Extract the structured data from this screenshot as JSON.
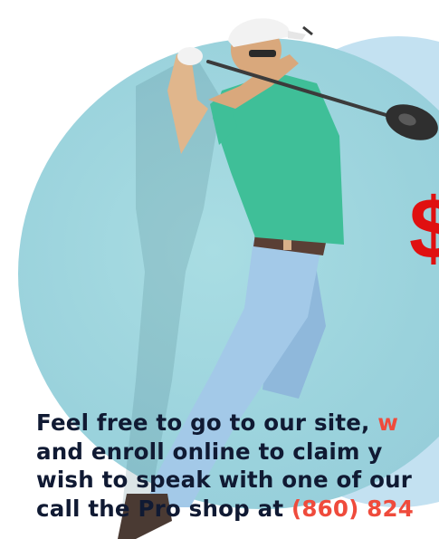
{
  "promo": {
    "dollar_sign": "$"
  },
  "body_text": {
    "line1": "Feel free to go to our site,",
    "line1_link": " w",
    "line2": "and enroll online to claim y",
    "line3": "wish to speak with one of our",
    "line4": "call the Pro shop at",
    "line4_phone": " (860) 824"
  },
  "colors": {
    "text": "#101a33",
    "accent": "#ef4b3c",
    "dollar": "#e01010",
    "circle": "#9ad2dc",
    "shirt": "#3fbf98",
    "pants": "#9ec6e6"
  }
}
